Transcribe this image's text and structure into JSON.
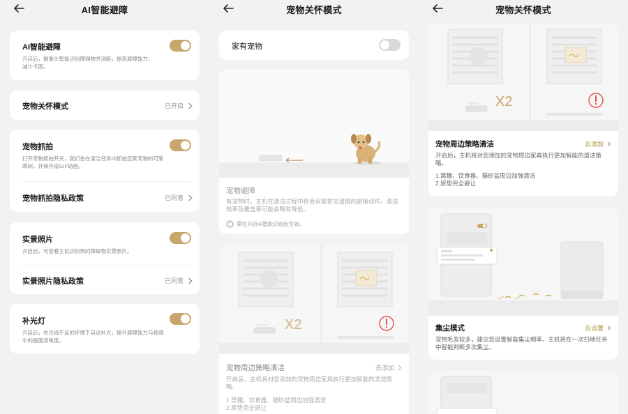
{
  "panel1": {
    "title": "AI智能避障",
    "ai_avoid": {
      "title": "AI智能避障",
      "desc": "开启后，摄像头智能识别障碍物并测距，提高避障能力，减少卡困。"
    },
    "pet_care": {
      "title": "宠物关怀模式",
      "status": "已开启"
    },
    "pet_snap": {
      "title": "宠物抓拍",
      "desc": "打开宠物抓拍开关，我们会在清洁任务中抓拍您家宠物的可爱瞬间，并保存成GIF动画。"
    },
    "pet_privacy": {
      "title": "宠物抓拍隐私政策",
      "status": "已同意"
    },
    "real_photo": {
      "title": "实景照片",
      "desc": "开启后，可查看主机识别到的障碍物实景照片。"
    },
    "photo_privacy": {
      "title": "实景照片隐私政策",
      "status": "已同意"
    },
    "fill_light": {
      "title": "补光灯",
      "desc": "开启后，在光线不足的环境下自动补光，提升避障能力与视频中的画面清晰度。"
    }
  },
  "panel2": {
    "title": "宠物关怀模式",
    "has_pet": {
      "label": "家有宠物"
    },
    "avoid": {
      "title": "宠物避障",
      "desc": "有宠物时，主机在清洁过程中将会采取更加谨慎的避障动作，清洁效率及覆盖率可能会略有降低。",
      "note": "需在开启AI智能识别后生效。"
    },
    "perimeter": {
      "title": "宠物周边策略清洁",
      "link": "去添加",
      "desc": "开启后，主机将对您添加的宠物周边家具执行更加智能的清洁策略。",
      "list": "1.窝棚、饮食器、猫砂盆周边加强清洁",
      "list2": "2.尿垫完全避让",
      "x2": "X2"
    }
  },
  "panel3": {
    "title": "宠物关怀模式",
    "perimeter": {
      "title": "宠物周边策略清洁",
      "link": "去添加",
      "desc": "开启后，主机将对您添加的宠物周边家具执行更加智能的清洁策略。",
      "list": "1.窝棚、饮食器、猫砂盆周边加强清洁",
      "list2": "2.尿垫完全避让",
      "x2": "X2"
    },
    "dust": {
      "title": "集尘模式",
      "link": "去设置",
      "desc": "宠物毛发较多，建议您设置智能集尘频率，主机将在一次扫地任务中智能判断多次集尘。"
    }
  },
  "colors": {
    "accent": "#c8a56b",
    "link": "#b28a47",
    "bg": "#f2f2f2",
    "warning": "#e05050"
  }
}
